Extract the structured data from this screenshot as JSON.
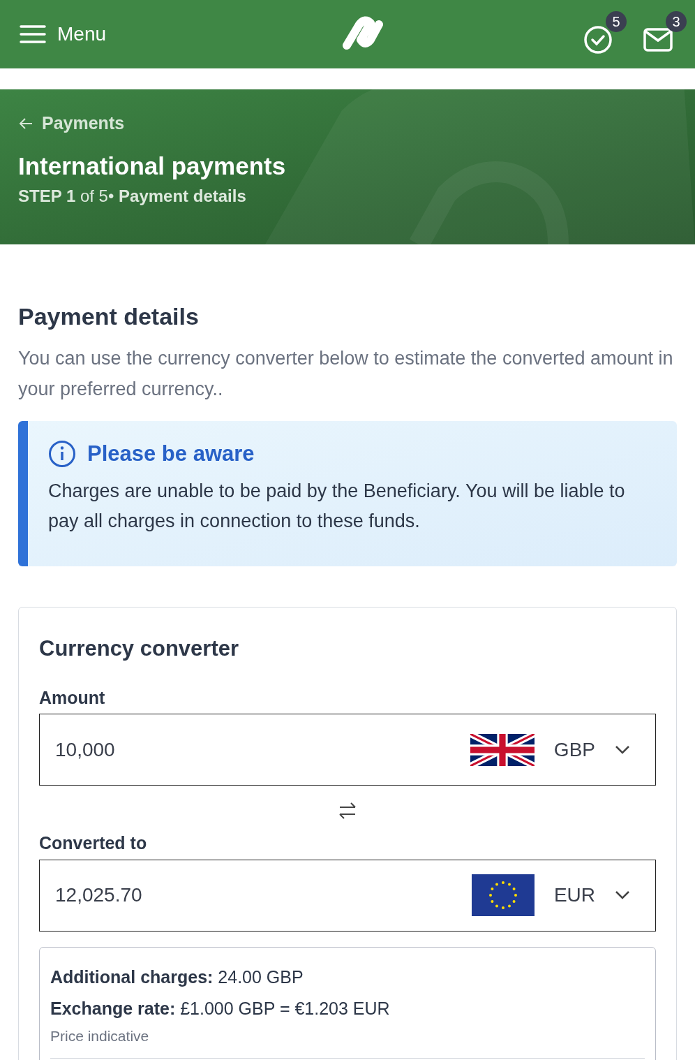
{
  "header": {
    "menu_label": "Menu",
    "tasks_badge": "5",
    "messages_badge": "3"
  },
  "banner": {
    "back_link": "Payments",
    "title": "International payments",
    "step": "**STEP 1** of 5• **Payment details**"
  },
  "section": {
    "title": "Payment details",
    "intro": "You can use the currency converter below to estimate the converted amount in your preferred currency.."
  },
  "notice": {
    "title": "Please be aware",
    "body": "Charges are unable to be paid by the Beneficiary. You will be liable to pay all charges in connection to these funds."
  },
  "converter": {
    "title": "Currency converter",
    "fields": [
      {
        "label": "Amount",
        "value": "10,000",
        "currency": "GBP",
        "kind": "uk"
      },
      {
        "label": "Converted to",
        "value": "12,025.70",
        "currency": "EUR",
        "kind": "eu"
      }
    ],
    "details": [
      "**Additional charges:** 24.00 GBP",
      "**Exchange rate:** £1.000 GBP = €1.203 EUR"
    ],
    "note": "Price indicative"
  }
}
